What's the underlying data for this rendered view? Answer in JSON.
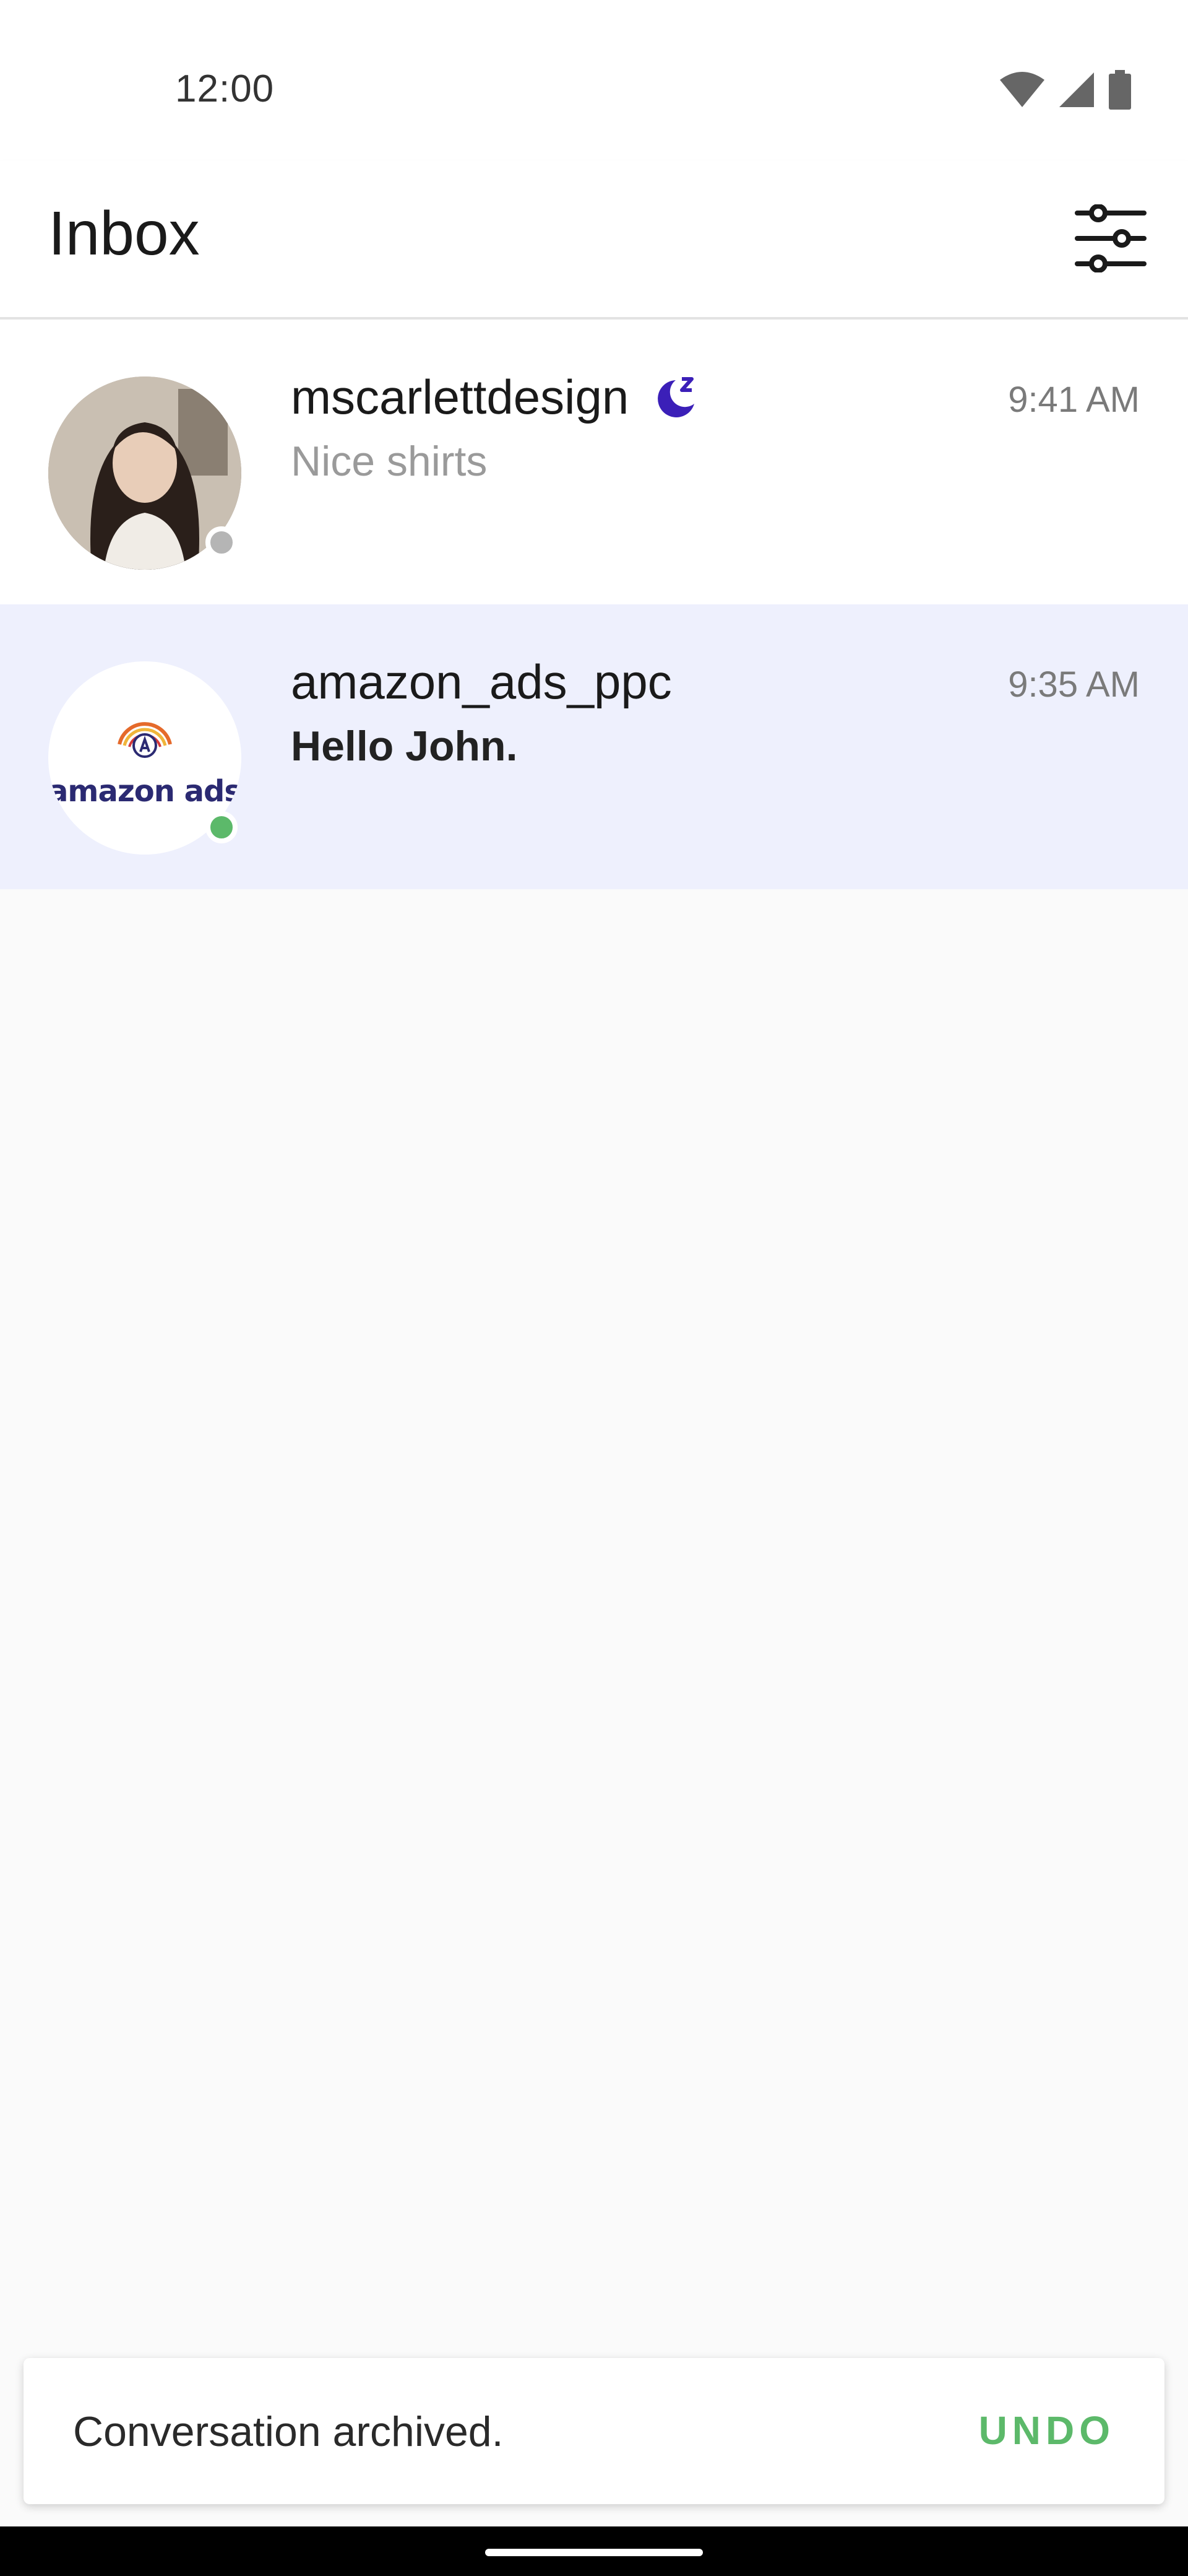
{
  "status_bar": {
    "time": "12:00",
    "icons": [
      "wifi-icon",
      "signal-icon",
      "battery-icon"
    ]
  },
  "header": {
    "title": "Inbox",
    "filter_icon": "sliders-icon"
  },
  "conversations": [
    {
      "name": "mscarlettdesign",
      "badge_icon": "snooze-moon-icon",
      "time": "9:41 AM",
      "preview": "Nice shirts",
      "unread": false,
      "presence": "offline"
    },
    {
      "name": "amazon_ads_ppc",
      "avatar_text": "amazon ads",
      "time": "9:35 AM",
      "preview": "Hello John.",
      "unread": true,
      "presence": "online"
    }
  ],
  "snackbar": {
    "message": "Conversation archived.",
    "action": "UNDO"
  },
  "colors": {
    "accent_green": "#5cb96a",
    "snooze_purple": "#3b1fb8",
    "selected_row": "#eef0fd"
  }
}
